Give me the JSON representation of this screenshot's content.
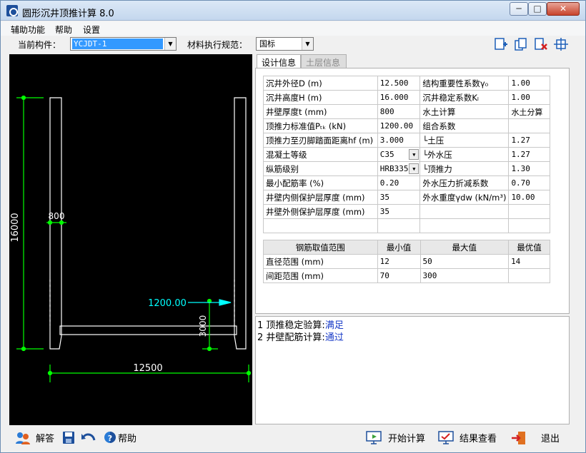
{
  "window": {
    "title": "圆形沉井顶推计算 8.0",
    "min": "─",
    "max": "□",
    "close": "✕"
  },
  "menu": [
    "辅助功能",
    "帮助",
    "设置"
  ],
  "toolbar": {
    "component_label": "当前构件：",
    "component_value": "YCJDT-1",
    "standard_label": "材料执行规范：",
    "standard_value": "国标"
  },
  "drawing": {
    "dim_height": "16000",
    "dim_wall": "800",
    "dim_push": "1200.00",
    "dim_blade": "3000",
    "dim_width": "12500",
    "colors": {
      "dim": "#00ff00",
      "push": "#00ffff",
      "line": "#ffffff"
    }
  },
  "tabs": [
    "设计信息",
    "土层信息"
  ],
  "design_table": [
    [
      "沉井外径D (m)",
      "12.500",
      "结构重要性系数γ₀",
      "1.00"
    ],
    [
      "沉井高度H (m)",
      "16.000",
      "沉井稳定系数Kₗ",
      "1.00"
    ],
    [
      "井壁厚度t (mm)",
      "800",
      "水土计算",
      "水土分算"
    ],
    [
      "顶推力标准值Pₜₖ (kN)",
      "1200.00",
      "组合系数",
      ""
    ],
    [
      "顶推力至刃脚踏面距离hf (m)",
      "3.000",
      "└土压",
      "1.27"
    ],
    [
      "混凝土等级",
      "C35",
      "└外水压",
      "1.27"
    ],
    [
      "纵筋级别",
      "HRB335",
      "└顶推力",
      "1.30"
    ],
    [
      "最小配筋率 (%)",
      "0.20",
      "外水压力折减系数",
      "0.70"
    ],
    [
      "井壁内侧保护层厚度 (mm)",
      "35",
      "外水重度γdw (kN/m³)",
      "10.00"
    ],
    [
      "井壁外侧保护层厚度 (mm)",
      "35",
      "",
      ""
    ],
    [
      "",
      "",
      "",
      ""
    ]
  ],
  "rebar_table": {
    "headers": [
      "钢筋取值范围",
      "最小值",
      "最大值",
      "最优值"
    ],
    "rows": [
      [
        "直径范围 (mm)",
        "12",
        "50",
        "14"
      ],
      [
        "间距范围 (mm)",
        "70",
        "300",
        ""
      ]
    ]
  },
  "results": [
    {
      "num": "1",
      "text": "顶推稳定验算:",
      "status": "满足"
    },
    {
      "num": "2",
      "text": "井壁配筋计算:",
      "status": "通过"
    }
  ],
  "statusbar": {
    "answer": "解答",
    "help": "帮助",
    "start": "开始计算",
    "view": "结果查看",
    "exit": "退出"
  }
}
